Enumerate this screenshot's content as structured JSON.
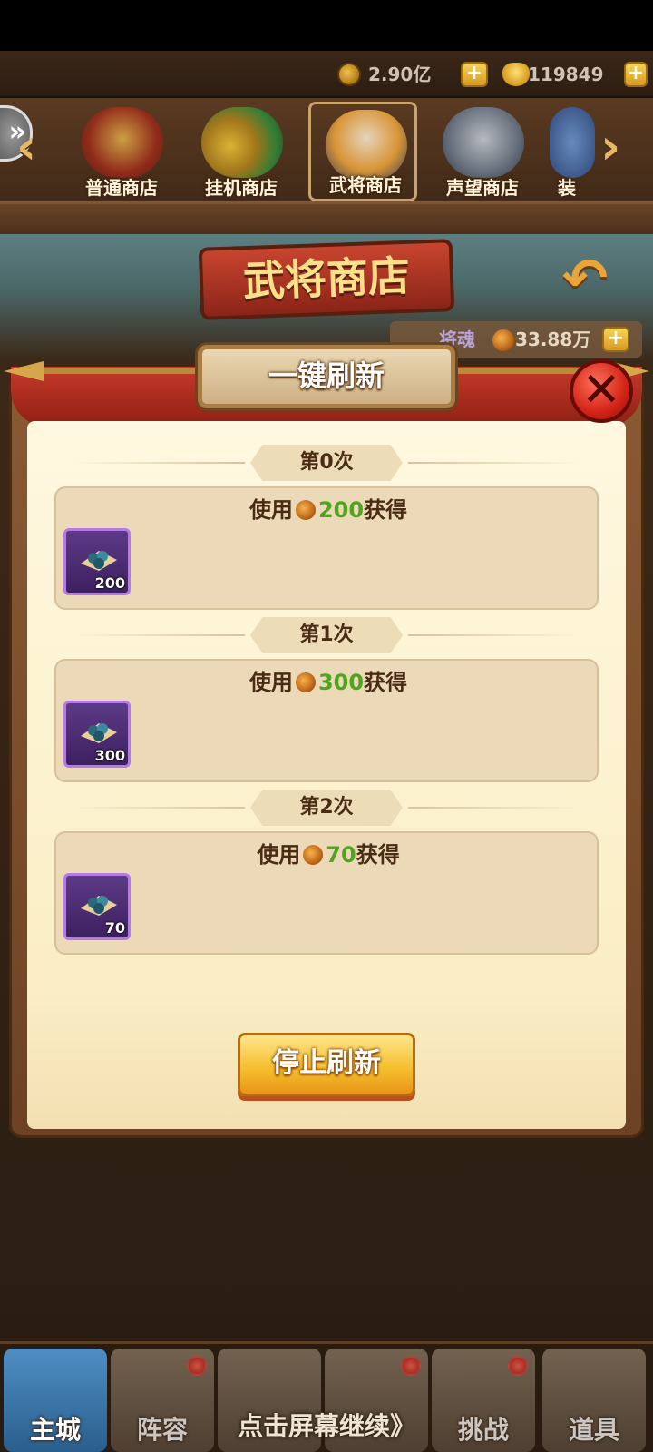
{
  "currency": {
    "gold_value": "2.90亿",
    "ingot_value": "119849",
    "plus_label": "+"
  },
  "shop_tabs": [
    {
      "label": "普通商店"
    },
    {
      "label": "挂机商店"
    },
    {
      "label": "武将商店",
      "selected": true
    },
    {
      "label": "声望商店"
    },
    {
      "label": "装"
    }
  ],
  "shop": {
    "title": "武将商店",
    "soul_label": "将魂",
    "soul_value": "33.88万"
  },
  "dialog": {
    "title": "一键刷新",
    "close_label": "✕",
    "rounds": [
      {
        "header": "第0次",
        "cost_prefix": "使用",
        "cost_amount": "200",
        "cost_suffix": "获得",
        "item_qty": "200"
      },
      {
        "header": "第1次",
        "cost_prefix": "使用",
        "cost_amount": "300",
        "cost_suffix": "获得",
        "item_qty": "300"
      },
      {
        "header": "第2次",
        "cost_prefix": "使用",
        "cost_amount": "70",
        "cost_suffix": "获得",
        "item_qty": "70"
      }
    ],
    "stop_button": "停止刷新"
  },
  "bottom_nav": [
    {
      "label": "主城",
      "selected": true
    },
    {
      "label": "阵容",
      "badge": true
    },
    {
      "label": "",
      "badge": false
    },
    {
      "label": "",
      "badge": true
    },
    {
      "label": "挑战",
      "badge": true
    },
    {
      "label": "道具"
    }
  ],
  "continue_hint": "点击屏幕继续》",
  "colors": {
    "accent_green": "#4fa51e",
    "close_red": "#d32416",
    "item_purple": "#b57ae8",
    "button_gold": "#f4bd2a"
  }
}
